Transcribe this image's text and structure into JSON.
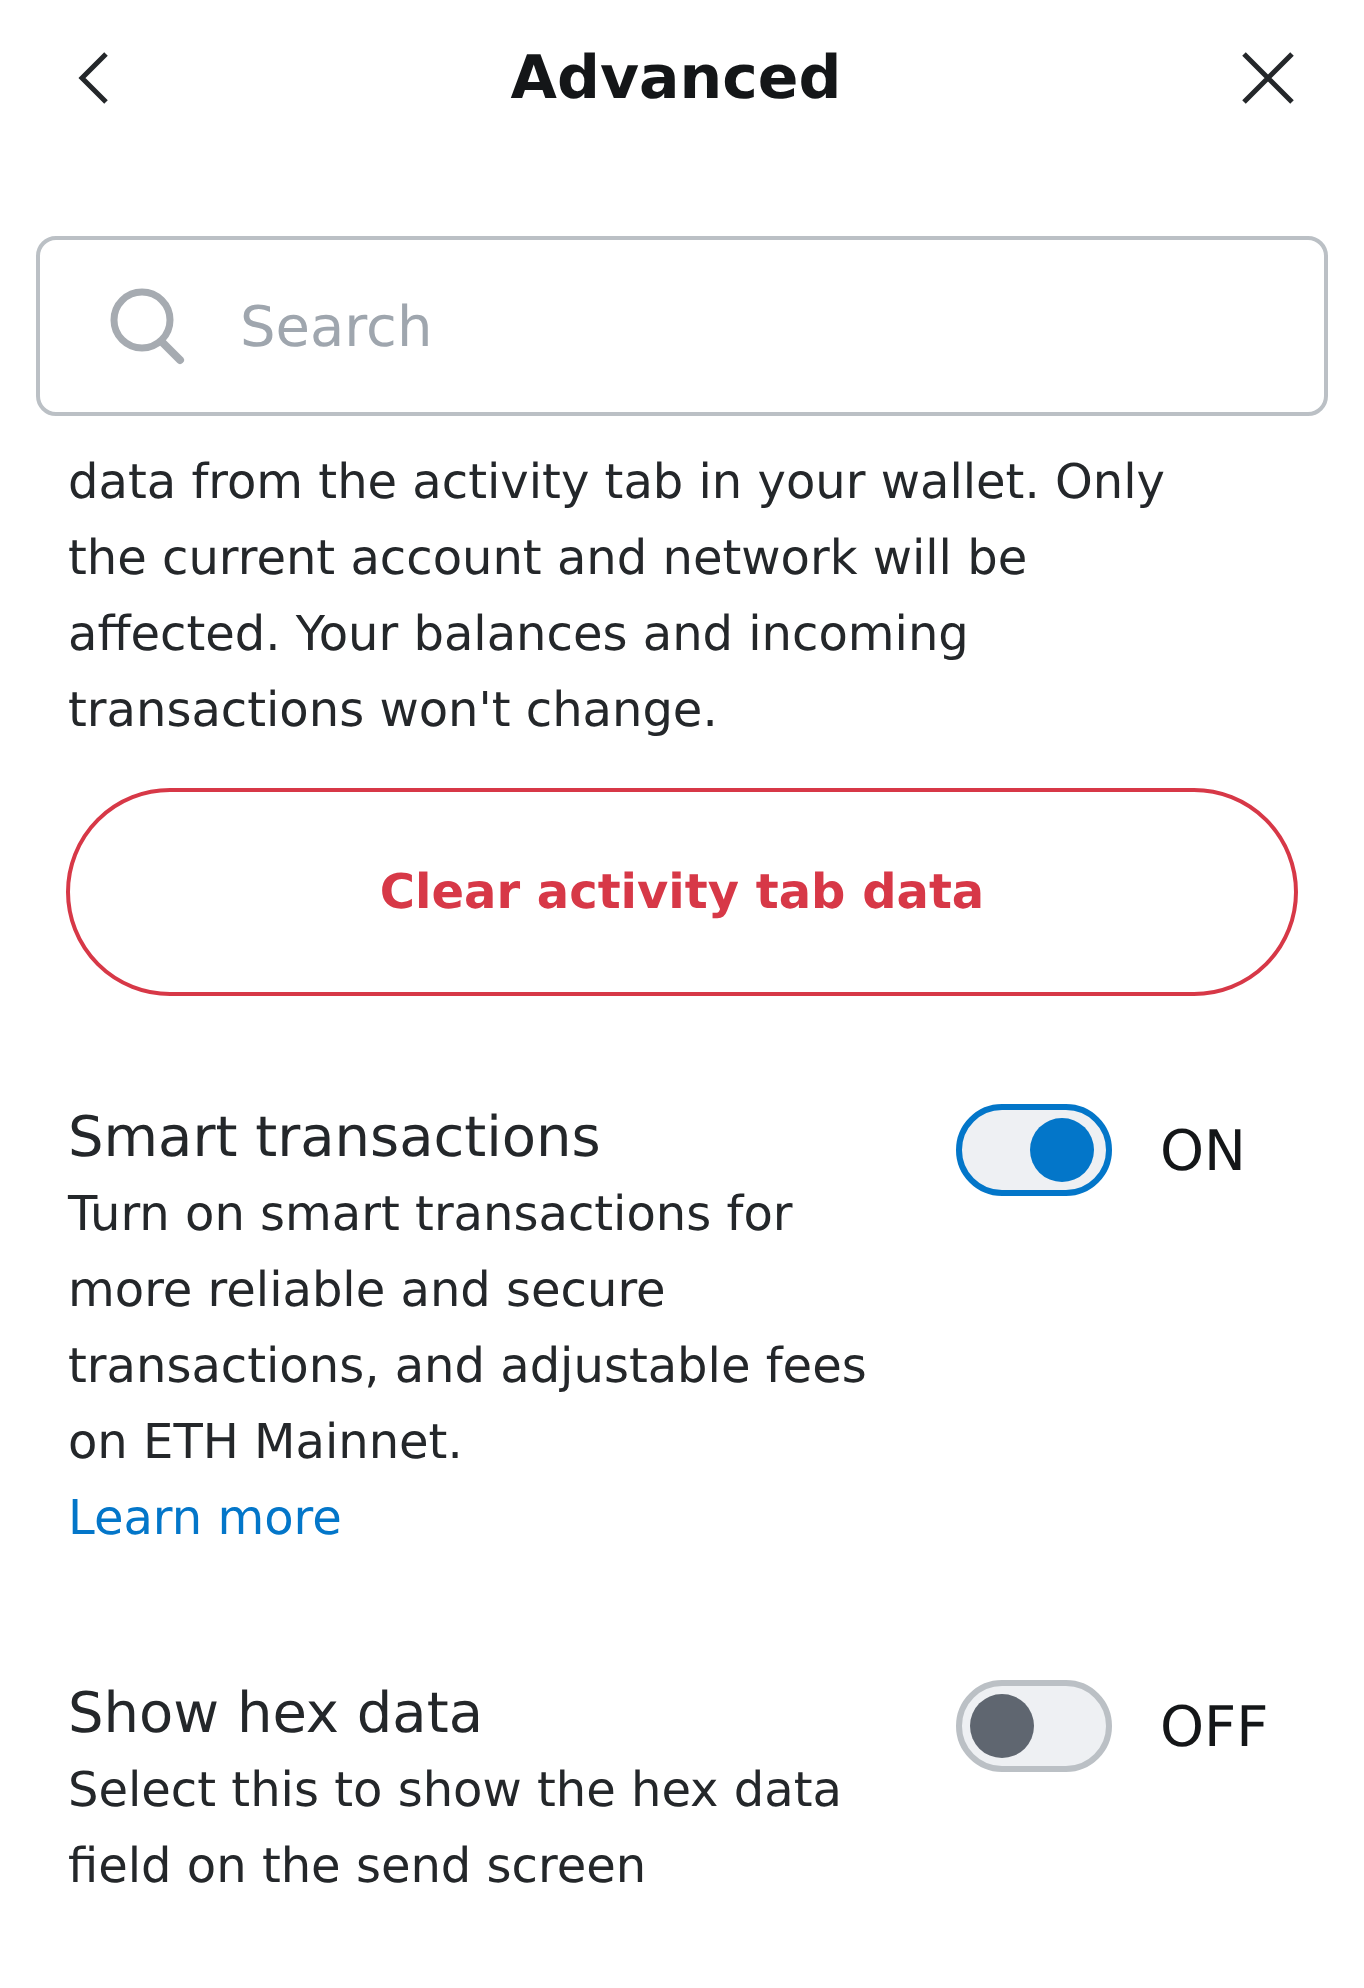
{
  "header": {
    "title": "Advanced"
  },
  "search": {
    "placeholder": "Search"
  },
  "intro": "data from the activity tab in your wallet. Only the current account and network will be affected. Your balances and incoming transactions won't change.",
  "clear_button": "Clear activity tab data",
  "settings": [
    {
      "title": "Smart transactions",
      "description": "Turn on smart transactions for more reliable and secure transactions, and adjustable fees on ETH Mainnet.",
      "link": "Learn more",
      "on": true,
      "state_label": "ON"
    },
    {
      "title": "Show hex data",
      "description": "Select this to show the hex data field on the send screen",
      "on": false,
      "state_label": "OFF"
    }
  ]
}
